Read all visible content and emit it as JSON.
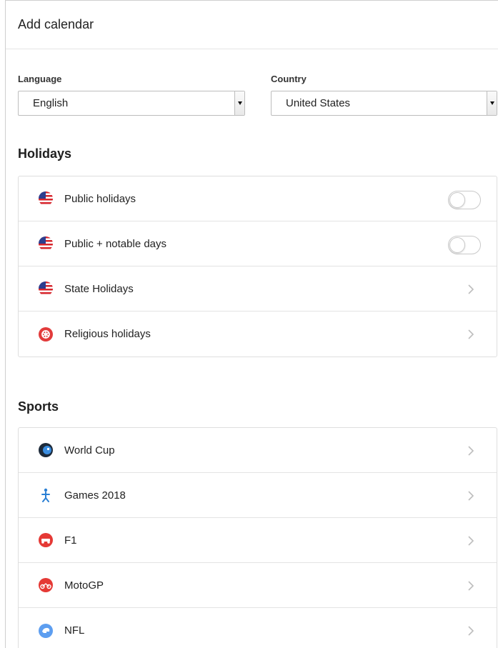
{
  "header": {
    "title": "Add calendar"
  },
  "selectors": {
    "language": {
      "label": "Language",
      "value": "English"
    },
    "country": {
      "label": "Country",
      "value": "United States"
    }
  },
  "holidays": {
    "title": "Holidays",
    "items": [
      {
        "label": "Public holidays",
        "icon": "us-flag-icon",
        "control": "toggle",
        "on": false
      },
      {
        "label": "Public + notable days",
        "icon": "us-flag-icon",
        "control": "toggle",
        "on": false
      },
      {
        "label": "State Holidays",
        "icon": "us-flag-icon",
        "control": "chevron"
      },
      {
        "label": "Religious holidays",
        "icon": "religious-icon",
        "control": "chevron"
      }
    ]
  },
  "sports": {
    "title": "Sports",
    "items": [
      {
        "label": "World Cup",
        "icon": "world-cup-icon"
      },
      {
        "label": "Games 2018",
        "icon": "games-2018-icon"
      },
      {
        "label": "F1",
        "icon": "f1-icon"
      },
      {
        "label": "MotoGP",
        "icon": "motogp-icon"
      },
      {
        "label": "NFL",
        "icon": "nfl-icon"
      }
    ]
  }
}
